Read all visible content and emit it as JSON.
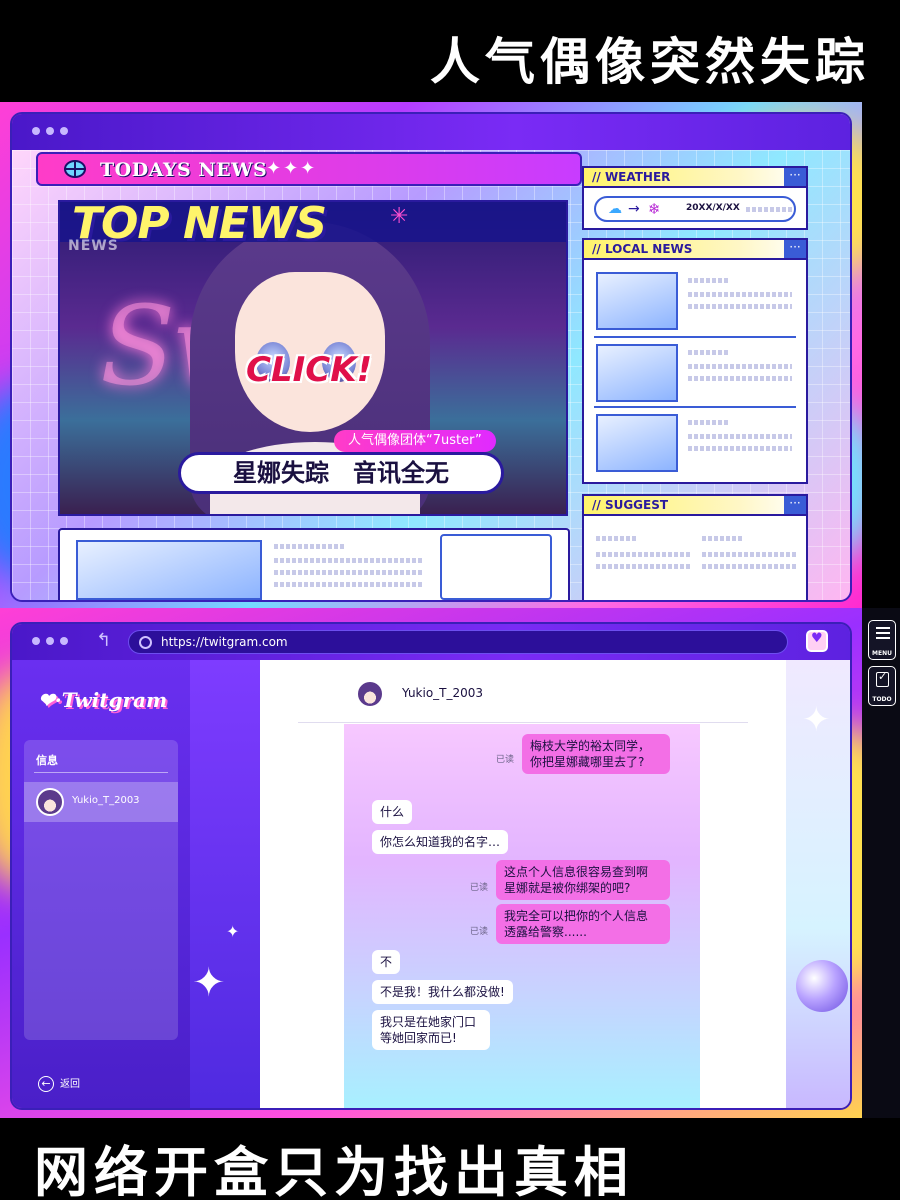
{
  "headlines": {
    "top": "人气偶像突然失踪",
    "bottom": "网络开盒只为找出真相"
  },
  "news_site": {
    "todays_news": "TODAYS NEWS",
    "sparkles": "✦✦✦",
    "top_news": {
      "title": "TOP NEWS",
      "tag": "NEWS",
      "click": "CLICK!",
      "caption_small": "人气偶像团体“7uster”",
      "caption_main": "星娜失踪　音讯全无",
      "sparkle": "✳"
    },
    "weather": {
      "title": "// WEATHER",
      "more": "···",
      "cloud_icon": "☁",
      "arrow_icon": "→",
      "snow_icon": "❄",
      "date": "20XX/X/XX"
    },
    "local_news": {
      "title": "// LOCAL NEWS",
      "more": "···"
    },
    "suggest": {
      "title": "// SUGGEST",
      "more": "···"
    }
  },
  "browser": {
    "url": "https://twitgram.com",
    "back_icon": "↰",
    "app_icon": "heart-app-icon"
  },
  "twitgram": {
    "logo": "❤·Twitgram",
    "messages_title": "信息",
    "contact_name": "Yukio_T_2003",
    "back_label": "返回",
    "back_icon": "←"
  },
  "chat": {
    "header_name": "Yukio_T_2003",
    "messages": [
      {
        "side": "out",
        "text": "梅枝大学的裕太同学，\n你把星娜藏哪里去了?",
        "read": "已读"
      },
      {
        "side": "in",
        "text": "什么"
      },
      {
        "side": "in",
        "text": "你怎么知道我的名字…"
      },
      {
        "side": "out",
        "text": "这点个人信息很容易查到啊\n星娜就是被你绑架的吧?",
        "read": "已读"
      },
      {
        "side": "out",
        "text": "我完全可以把你的个人信息\n透露给警察......",
        "read": "已读"
      },
      {
        "side": "in",
        "text": "不"
      },
      {
        "side": "in",
        "text": "不是我！我什么都没做!"
      },
      {
        "side": "in",
        "text": "我只是在她家门口\n等她回家而已!"
      }
    ]
  },
  "side_buttons": {
    "menu": "MENU",
    "todo": "TODO"
  },
  "colors": {
    "accent_purple": "#7a2bf5",
    "accent_pink": "#ff3cc8",
    "outgoing_bubble": "#f36fe6",
    "headline_text": "#ffffff"
  }
}
